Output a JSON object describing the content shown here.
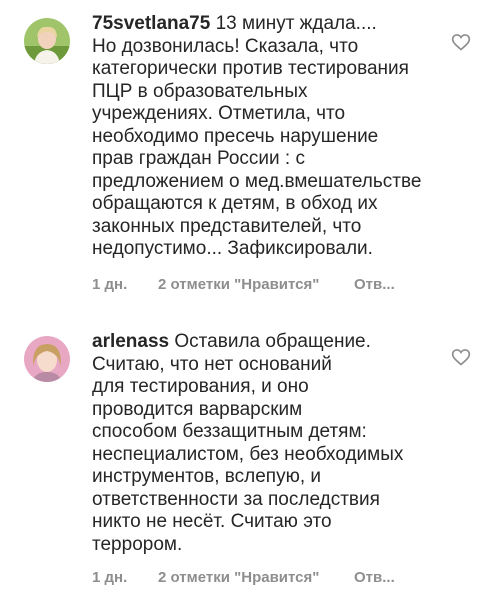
{
  "comments": [
    {
      "username": "75svetlana75",
      "text": " 13 минут ждала....\nНо дозвонилась! Сказала, что\nкатегорически против тестирования\nПЦР в образовательных\nучреждениях. Отметила, что\nнеобходимо пресечь нарушение\nправ граждан России : с\nпредложением о мед.вмешательстве\nобращаются к детям, в обход их\nзаконных представителей, что\nнедопустимо... Зафиксировали.",
      "time": "1 дн.",
      "likes": "2 отметки \"Нравится\"",
      "reply": "Отв...",
      "avatar_icon": "avatar-woman-green-background",
      "like_icon": "heart-outline-icon"
    },
    {
      "username": "arlenass",
      "text": " Оставила обращение.\nСчитаю, что нет оснований\nдля тестирования, и оно\nпроводится варварским\nспособом  беззащитным детям:\nнеспециалистом, без необходимых\nинструментов, вслепую, и\nответственности за последствия\nникто не несёт. Считаю это\nтеррором.",
      "time": "1 дн.",
      "likes": "2 отметки \"Нравится\"",
      "reply": "Отв...",
      "avatar_icon": "avatar-woman-pink-background",
      "like_icon": "heart-outline-icon"
    }
  ]
}
